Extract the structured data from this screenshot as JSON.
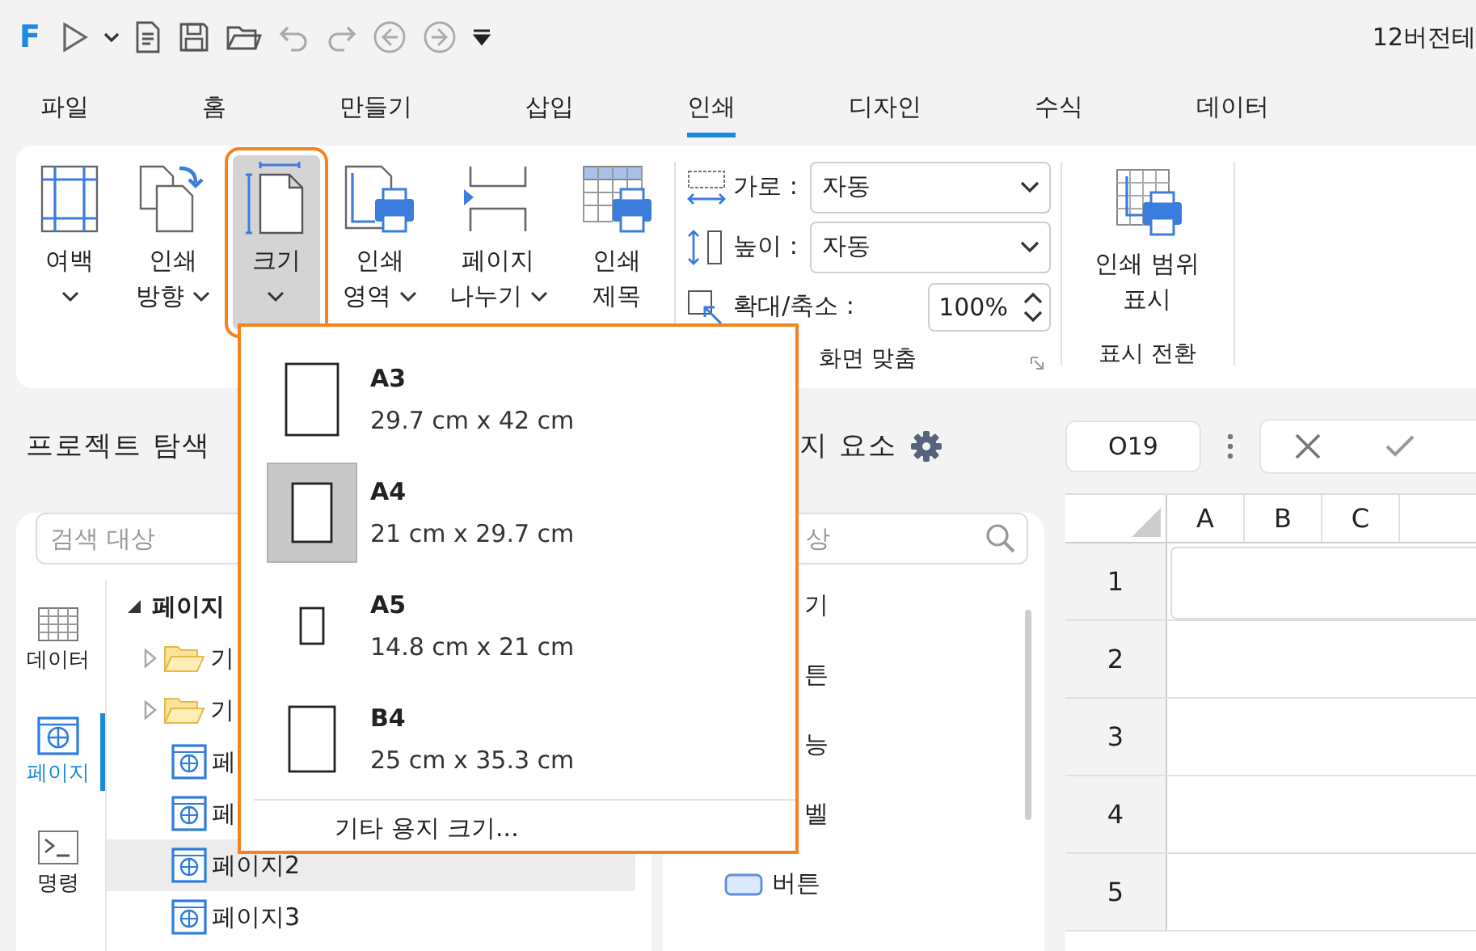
{
  "quick_access": {
    "logo": "F",
    "title": "12버전테"
  },
  "menu_tabs": [
    {
      "label": "파일",
      "selected": false
    },
    {
      "label": "홈",
      "selected": false
    },
    {
      "label": "만들기",
      "selected": false
    },
    {
      "label": "삽입",
      "selected": false
    },
    {
      "label": "인쇄",
      "selected": true
    },
    {
      "label": "디자인",
      "selected": false
    },
    {
      "label": "수식",
      "selected": false
    },
    {
      "label": "데이터",
      "selected": false
    }
  ],
  "ribbon": {
    "buttons": [
      {
        "lines": [
          "여백"
        ],
        "kind": "margin",
        "dropdown": true,
        "selected": false
      },
      {
        "lines": [
          "인쇄",
          "방향"
        ],
        "kind": "orientation",
        "dropdown": true,
        "selected": false
      },
      {
        "lines": [
          "크기"
        ],
        "kind": "size",
        "dropdown": true,
        "selected": true
      },
      {
        "lines": [
          "인쇄",
          "영역"
        ],
        "kind": "area",
        "dropdown": true,
        "selected": false
      },
      {
        "lines": [
          "페이지",
          "나누기"
        ],
        "kind": "break",
        "dropdown": true,
        "selected": false
      },
      {
        "lines": [
          "인쇄",
          "제목"
        ],
        "kind": "titles",
        "dropdown": false,
        "selected": false
      }
    ],
    "fit_group": {
      "fields": [
        {
          "label": "가로 :",
          "value": "자동",
          "kind": "select"
        },
        {
          "label": "높이 :",
          "value": "자동",
          "kind": "select"
        },
        {
          "label": "확대/축소 :",
          "value": "100%",
          "kind": "spin"
        }
      ],
      "label": "화면 맞춤"
    },
    "display_group": {
      "lines": [
        "인쇄 범위",
        "표시"
      ],
      "label": "표시 전환"
    }
  },
  "paper_menu": {
    "items": [
      {
        "name": "A3",
        "size": "29.7 cm x 42 cm",
        "selected": false
      },
      {
        "name": "A4",
        "size": "21 cm x 29.7 cm",
        "selected": true
      },
      {
        "name": "A5",
        "size": "14.8 cm x 21 cm",
        "selected": false
      },
      {
        "name": "B4",
        "size": "25 cm x 35.3 cm",
        "selected": false
      }
    ],
    "footer": "기타 용지 크기..."
  },
  "explorer": {
    "title": "프로젝트 탐색",
    "search": {
      "placeholder": "검색 대상"
    },
    "side_tabs": [
      {
        "label": "데이터",
        "kind": "data",
        "selected": false
      },
      {
        "label": "페이지",
        "kind": "page",
        "selected": true
      },
      {
        "label": "명령",
        "kind": "command",
        "selected": false
      }
    ],
    "tree": {
      "label": "페이지",
      "expanded": true,
      "selected": false,
      "children": [
        {
          "label": "기",
          "kind": "folder",
          "expanded": false,
          "selected": false
        },
        {
          "label": "기",
          "kind": "folder",
          "expanded": false,
          "selected": false
        },
        {
          "label": "페",
          "kind": "page",
          "selected": false
        },
        {
          "label": "페",
          "kind": "page",
          "selected": false
        },
        {
          "label": "페이지2",
          "kind": "page",
          "selected": true
        },
        {
          "label": "페이지3",
          "kind": "page",
          "selected": false
        }
      ]
    }
  },
  "elements": {
    "title": "지 요소",
    "search": {
      "placeholder": "상"
    },
    "items": [
      {
        "label": "기",
        "kind": "plain"
      },
      {
        "label": "튼",
        "kind": "plain"
      },
      {
        "label": "능",
        "kind": "plain"
      },
      {
        "label": "벨",
        "kind": "plain"
      },
      {
        "label": "버튼",
        "kind": "button"
      }
    ]
  },
  "sheet": {
    "name_box": "O19",
    "columns": [
      "A",
      "B",
      "C"
    ],
    "rows": [
      "1",
      "2",
      "3",
      "4",
      "5"
    ]
  }
}
